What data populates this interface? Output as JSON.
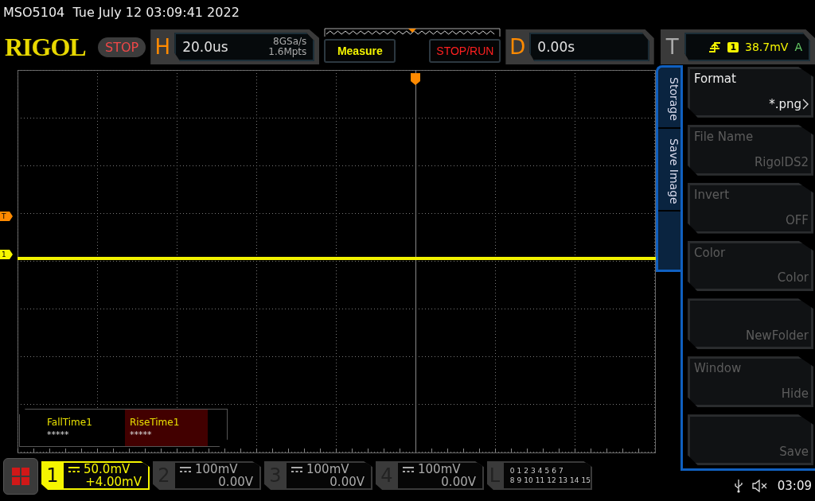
{
  "status_line": "MSO5104  Tue July 12 03:09:41 2022",
  "header": {
    "logo": "RIGOL",
    "run_state": "STOP",
    "horizontal": {
      "label": "H",
      "timebase": "20.0us",
      "sample_rate": "8GSa/s",
      "memory_depth": "1.6Mpts"
    },
    "measure_button": "Measure",
    "stop_run_button": "STOP/RUN",
    "delay": {
      "label": "D",
      "value": "0.00s"
    },
    "trigger": {
      "label": "T",
      "source": "1",
      "level": "38.7mV",
      "mode": "A"
    }
  },
  "display": {
    "markers": [
      {
        "kind": "trigger_level",
        "label": "T"
      },
      {
        "kind": "channel",
        "label": "1"
      }
    ]
  },
  "measurements": [
    {
      "name": "FallTime1",
      "value": "*****",
      "selected": false
    },
    {
      "name": "RiseTime1",
      "value": "*****",
      "selected": true
    }
  ],
  "menu": {
    "tabs": [
      {
        "label": "Storage"
      },
      {
        "label": "Save Image"
      }
    ],
    "items": [
      {
        "label": "Format",
        "value": "*.png",
        "disabled": false,
        "submenu": true
      },
      {
        "label": "File Name",
        "value": "RigolDS2",
        "disabled": true,
        "submenu": false
      },
      {
        "label": "Invert",
        "value": "OFF",
        "disabled": true,
        "submenu": false
      },
      {
        "label": "Color",
        "value": "Color",
        "disabled": true,
        "submenu": false
      },
      {
        "value": "NewFolder",
        "disabled": true,
        "submenu": false
      },
      {
        "label": "Window",
        "value": "Hide",
        "disabled": true,
        "submenu": false
      },
      {
        "value": "Save",
        "disabled": true,
        "submenu": false
      }
    ]
  },
  "channels": [
    {
      "number": "1",
      "scale": "50.0mV",
      "offset": "+4.00mV",
      "selected": true
    },
    {
      "number": "2",
      "scale": "100mV",
      "offset": "0.00V",
      "selected": false
    },
    {
      "number": "3",
      "scale": "100mV",
      "offset": "0.00V",
      "selected": false
    },
    {
      "number": "4",
      "scale": "100mV",
      "offset": "0.00V",
      "selected": false
    }
  ],
  "logic": {
    "label": "L",
    "bits_row_1": [
      "0",
      "1",
      "2",
      "3",
      "4",
      "5",
      "6",
      "7"
    ],
    "bits_row_2": [
      "8",
      "9",
      "10",
      "11",
      "12",
      "13",
      "14",
      "15"
    ]
  },
  "status": {
    "time": "03:09"
  }
}
